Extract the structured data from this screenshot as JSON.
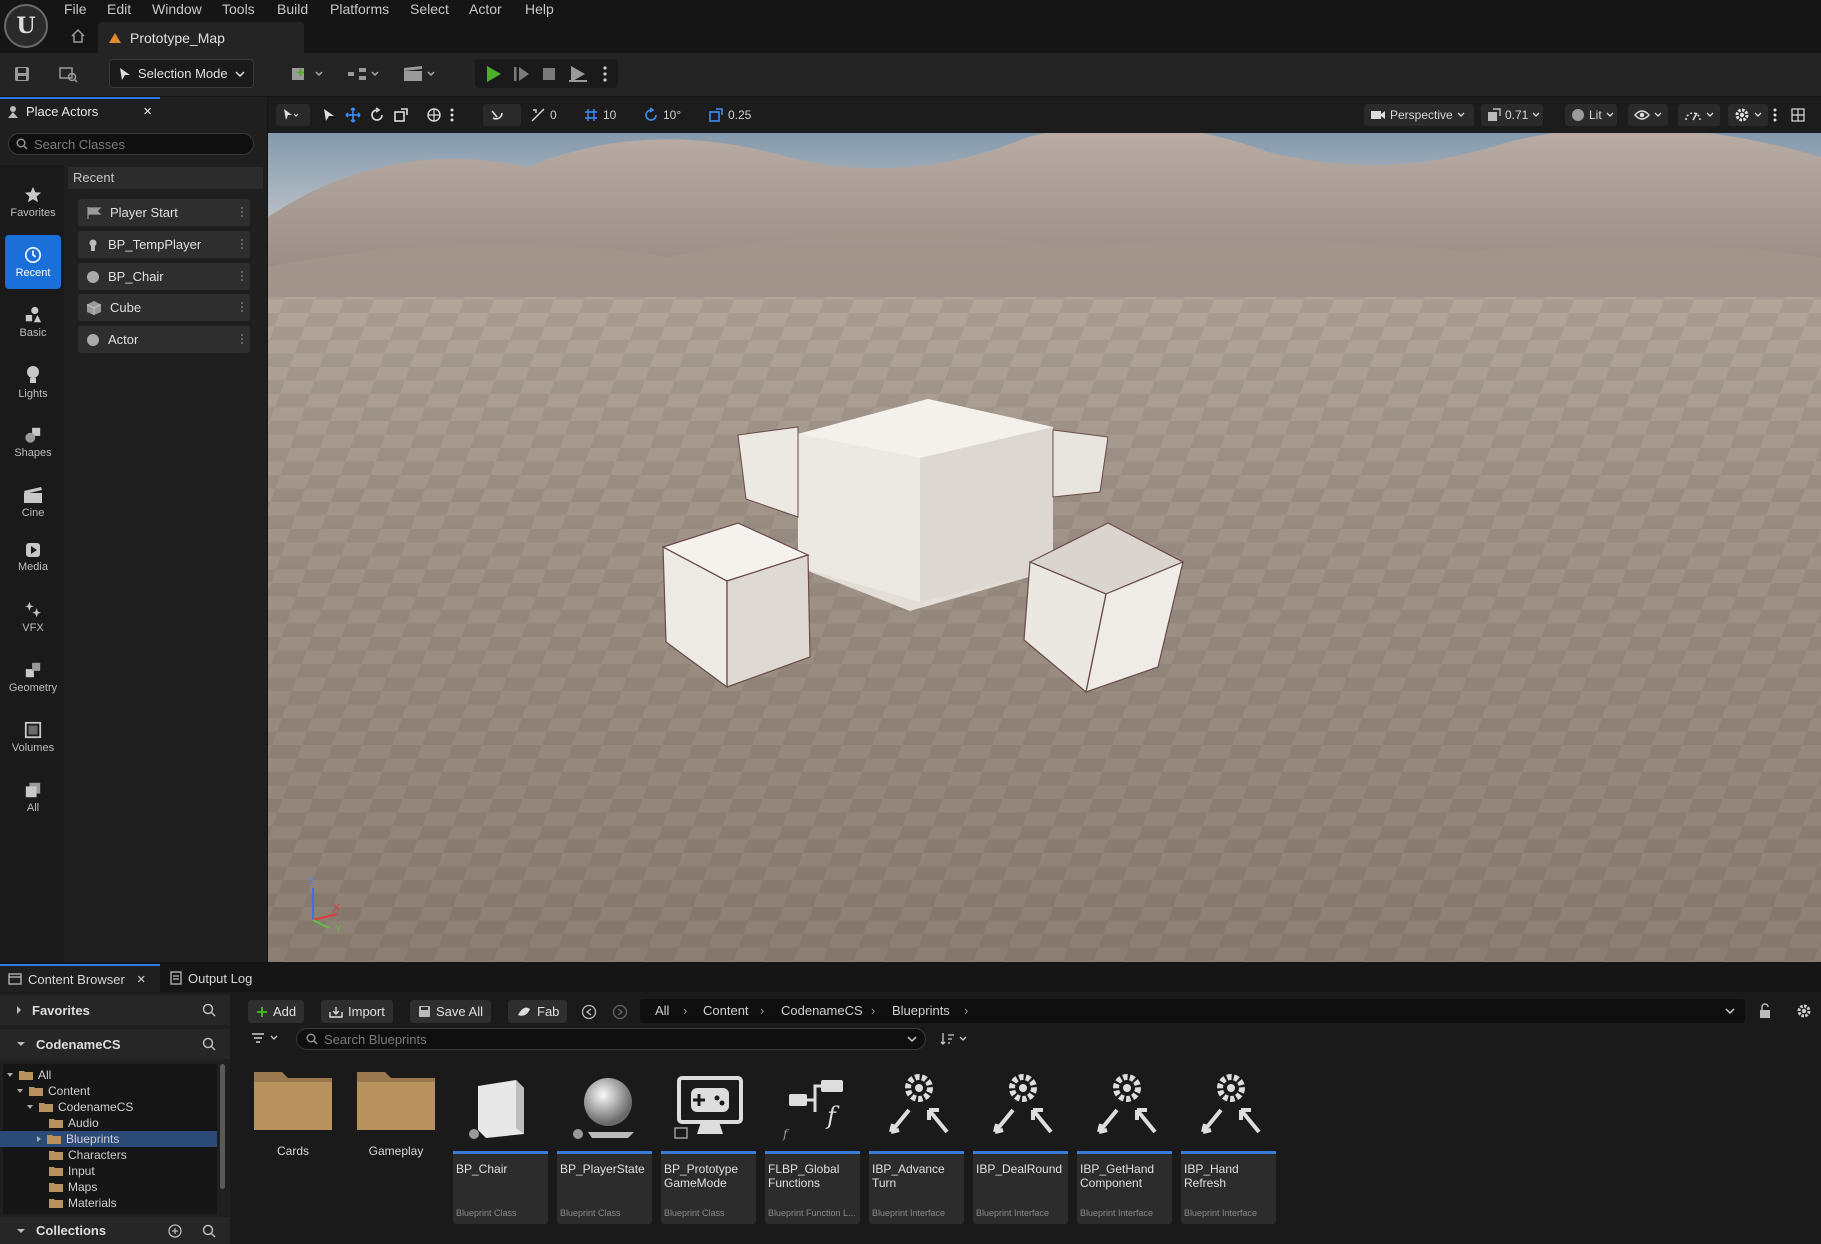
{
  "app": {
    "logo": "U"
  },
  "menu": [
    "File",
    "Edit",
    "Window",
    "Tools",
    "Build",
    "Platforms",
    "Select",
    "Actor",
    "Help"
  ],
  "document_tab": {
    "title": "Prototype_Map"
  },
  "toolbar": {
    "selection_mode": "Selection Mode"
  },
  "place_actors": {
    "tab_label": "Place Actors",
    "search_placeholder": "Search Classes",
    "section": "Recent",
    "categories": [
      "Favorites",
      "Recent",
      "Basic",
      "Lights",
      "Shapes",
      "Cine",
      "Media",
      "VFX",
      "Geometry",
      "Volumes",
      "All"
    ],
    "items": [
      "Player Start",
      "BP_TempPlayer",
      "BP_Chair",
      "Cube",
      "Actor"
    ]
  },
  "viewport": {
    "translate_snap": "0",
    "grid_snap": "10",
    "rotation_snap": "10°",
    "scale_snap": "0.25",
    "view_mode": "Perspective",
    "camera_speed": "0.71",
    "lighting": "Lit",
    "axis_labels": {
      "z": "Z",
      "x": "X",
      "y": "Y"
    }
  },
  "bottom_tabs": {
    "content_browser": "Content Browser",
    "output_log": "Output Log"
  },
  "content_browser": {
    "favorites": "Favorites",
    "project": "CodenameCS",
    "collections": "Collections",
    "tree": [
      "All",
      "Content",
      "CodenameCS",
      "Audio",
      "Blueprints",
      "Characters",
      "Input",
      "Maps",
      "Materials"
    ],
    "buttons": {
      "add": "Add",
      "import": "Import",
      "save_all": "Save All",
      "fab": "Fab"
    },
    "breadcrumb": [
      "All",
      "Content",
      "CodenameCS",
      "Blueprints"
    ],
    "search_placeholder": "Search Blueprints",
    "folders": [
      "Cards",
      "Gameplay"
    ],
    "assets": [
      {
        "name": "BP_Chair",
        "type": "Blueprint Class"
      },
      {
        "name": "BP_PlayerState",
        "type": "Blueprint Class"
      },
      {
        "name": "BP_Prototype GameMode",
        "type": "Blueprint Class"
      },
      {
        "name": "FLBP_Global Functions",
        "type": "Blueprint Function L..."
      },
      {
        "name": "IBP_Advance Turn",
        "type": "Blueprint Interface"
      },
      {
        "name": "IBP_DealRound",
        "type": "Blueprint Interface"
      },
      {
        "name": "IBP_GetHand Component",
        "type": "Blueprint Interface"
      },
      {
        "name": "IBP_Hand Refresh",
        "type": "Blueprint Interface"
      }
    ]
  },
  "colors": {
    "accent": "#1a6fd8",
    "play": "#4caf2a",
    "selection": "#2f7ae5",
    "folder": "#b8925e"
  }
}
